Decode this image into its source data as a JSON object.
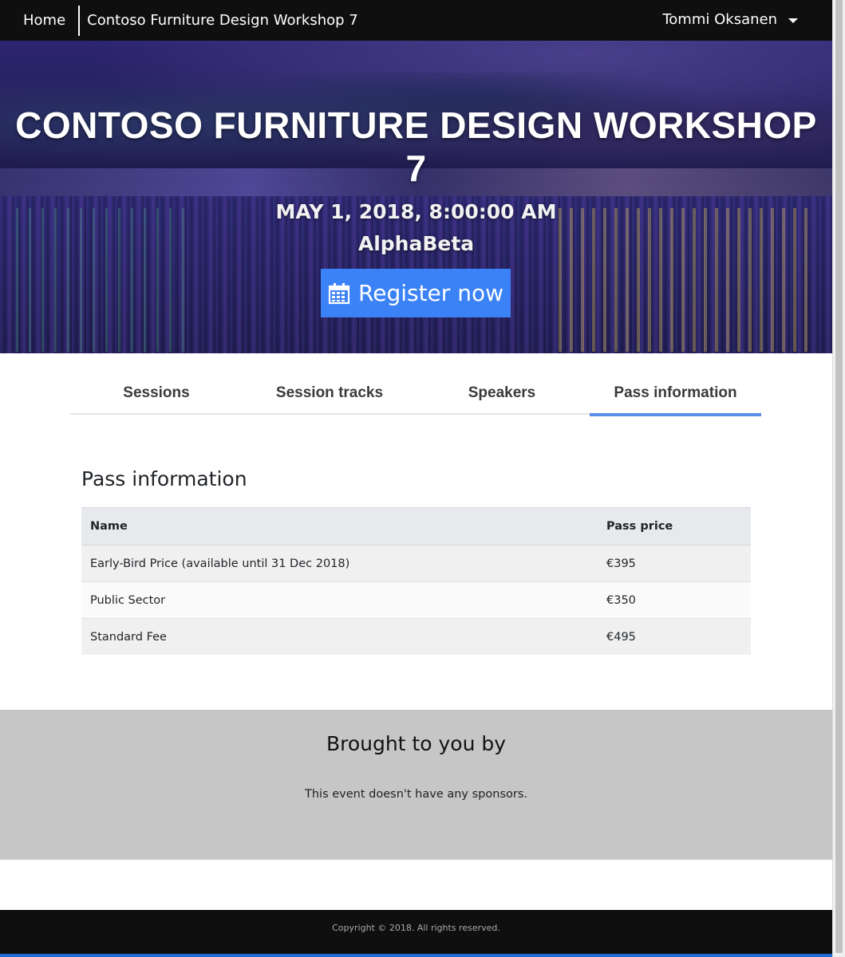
{
  "nav": {
    "home_label": "Home",
    "event_title": "Contoso Furniture Design Workshop 7",
    "user_name": "Tommi Oksanen"
  },
  "hero": {
    "title": "CONTOSO FURNITURE DESIGN WORKSHOP 7",
    "date": "MAY 1, 2018, 8:00:00 AM",
    "venue": "AlphaBeta",
    "register_label": "Register now",
    "register_icon": "calendar-icon",
    "button_color": "#3b82f6"
  },
  "tabs": [
    {
      "label": "Sessions",
      "active": false
    },
    {
      "label": "Session tracks",
      "active": false
    },
    {
      "label": "Speakers",
      "active": false
    },
    {
      "label": "Pass information",
      "active": true
    }
  ],
  "pass_info": {
    "heading": "Pass information",
    "columns": [
      "Name",
      "Pass price"
    ],
    "rows": [
      [
        "Early-Bird Price (available until 31 Dec 2018)",
        "€395"
      ],
      [
        "Public Sector",
        "€350"
      ],
      [
        "Standard Fee",
        "€495"
      ]
    ]
  },
  "sponsors": {
    "heading": "Brought to you by",
    "text": "This event doesn't have any sponsors."
  },
  "footer": {
    "copyright": "Copyright © 2018. All rights reserved."
  },
  "colors": {
    "accent": "#5a8de8",
    "nav_bg": "#0f0f10",
    "sponsor_bg": "#c6c6c6"
  }
}
